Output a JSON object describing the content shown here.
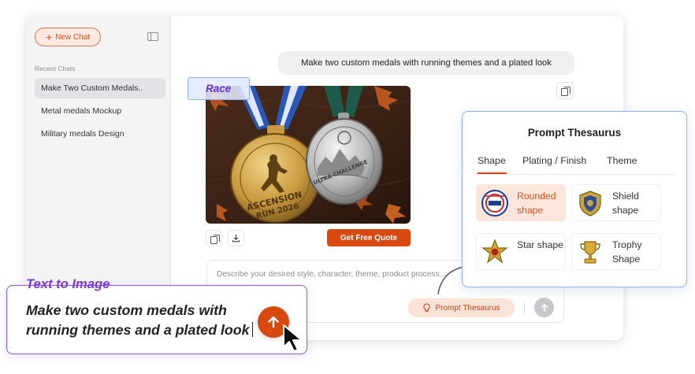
{
  "sidebar": {
    "new_chat_label": "New Chat",
    "recent_label": "Recent Chats",
    "chats": [
      {
        "label": "Make Two Custom Medals.."
      },
      {
        "label": "Metal medals Mockup"
      },
      {
        "label": "Military medals Design"
      }
    ]
  },
  "conversation": {
    "user_message": "Make two custom medals with running themes and a plated look",
    "quote_button": "Get Free Quote",
    "image_overlay": {
      "gold_medal_text": "ASCENSION RUN 2026",
      "silver_medal_text": "ULTRA CHALLENGE"
    }
  },
  "composer": {
    "placeholder": "Describe your desired style, character, theme, product process...",
    "prompt_thesaurus_label": "Prompt Thesaurus"
  },
  "race_tag": "Race",
  "thesaurus": {
    "title": "Prompt Thesaurus",
    "tabs": [
      "Shape",
      "Plating / Finish",
      "Theme"
    ],
    "active_tab": "Shape",
    "shapes": [
      {
        "label": "Rounded shape",
        "selected": true
      },
      {
        "label": "Shield shape",
        "selected": false
      },
      {
        "label": "Star shape",
        "selected": false
      },
      {
        "label": "Trophy Shape",
        "selected": false
      }
    ]
  },
  "text_to_image": {
    "title": "Text to Image",
    "prompt_text": "Make two custom medals with running themes and a plated look"
  },
  "colors": {
    "accent": "#d9480f",
    "purple": "#7a3bdb",
    "blue_border": "#8eaff0"
  }
}
